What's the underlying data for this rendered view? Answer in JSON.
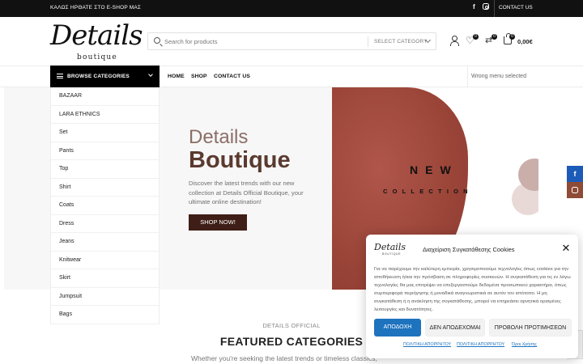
{
  "topbar": {
    "welcome": "ΚΑΛΩΣ ΗΡΘΑΤΕ ΣΤΟ E-SHOP ΜΑΣ",
    "contact_label": "CONTACT US"
  },
  "logo": {
    "script": "Details",
    "sub": "boutique"
  },
  "search": {
    "placeholder": "Search for products",
    "category_label": "SELECT CATEGORY"
  },
  "header_icons": {
    "wishlist_count": "0",
    "compare_count": "0",
    "cart_count": "0",
    "cart_total": "0,00€"
  },
  "nav": {
    "browse_label": "BROWSE CATEGORIES",
    "links": [
      "HOME",
      "SHOP",
      "CONTACT US"
    ],
    "secondary": "Wrong menu selected"
  },
  "categories": [
    "BAZAAR",
    "LARA ETHNICS",
    "Set",
    "Pants",
    "Top",
    "Shirt",
    "Coats",
    "Dress",
    "Jeans",
    "Knitwear",
    "Skirt",
    "Jumpsuit",
    "Bags"
  ],
  "hero": {
    "small_title": "Details",
    "big_title": "Boutique",
    "description": "Discover the latest trends with our new collection at Details Official Boutique, your ultimate online destination!",
    "button": "SHOP NOW!",
    "art_word1": "NEW",
    "art_word2": "COLLECTION"
  },
  "section": {
    "kicker": "DETAILS OFFICIAL",
    "title": "FEATURED CATEGORIES",
    "description": "Whether you're seeking the latest trends or timeless classics,"
  },
  "cookie": {
    "logo": "Details",
    "logo_sub": "BOUTIQUE",
    "title": "Διαχείριση Συγκατάθεσης Cookies",
    "text": "Για να παρέχουμε την καλύτερη εμπειρία, χρησιμοποιούμε τεχνολογίες όπως cookies για την αποθήκευση ή/και την πρόσβαση σε πληροφορίες συσκευών. Η συγκατάθεση για τις εν λόγω τεχνολογίες θα μας επιτρέψει να επεξεργαστούμε δεδομένα προσωπικού χαρακτήρα, όπως συμπεριφορά περιήγησης ή μοναδικά αναγνωριστικά σε αυτόν τον ιστότοπο. Η μη συγκατάθεση ή η ανάκληση της συγκατάθεσης, μπορεί να επηρεάσει αρνητικά ορισμένες λειτουργίες και δυνατότητες.",
    "accept": "ΑΠΟΔΟΧΗ",
    "deny": "ΔΕΝ ΑΠΟΔΕΧΟΜΑΙ",
    "preferences": "ΠΡΟΒΟΛΗ ΠΡΟΤΙΜΗΣΕΩΝ",
    "links": [
      "ΠΟΛΙΤΙΚΗ ΑΠΟΡΡΗΤΟΥ",
      "ΠΟΛΙΤΙΚΗ ΑΠΟΡΡΗΤΟΥ",
      "Όροι Χρήσης"
    ]
  },
  "side_social": {
    "facebook_glyph": "f"
  },
  "colors": {
    "topbar": "#111111",
    "hero_button": "#3e1e16",
    "hero_title": "#5a3a2f",
    "accept_button": "#1e73be",
    "facebook": "#1c5bb8",
    "instagram": "#8e4b36"
  },
  "icons": [
    "facebook-icon",
    "instagram-icon",
    "search-icon",
    "user-icon",
    "heart-icon",
    "compare-icon",
    "cart-icon",
    "menu-icon",
    "chevron-down-icon",
    "close-icon"
  ]
}
